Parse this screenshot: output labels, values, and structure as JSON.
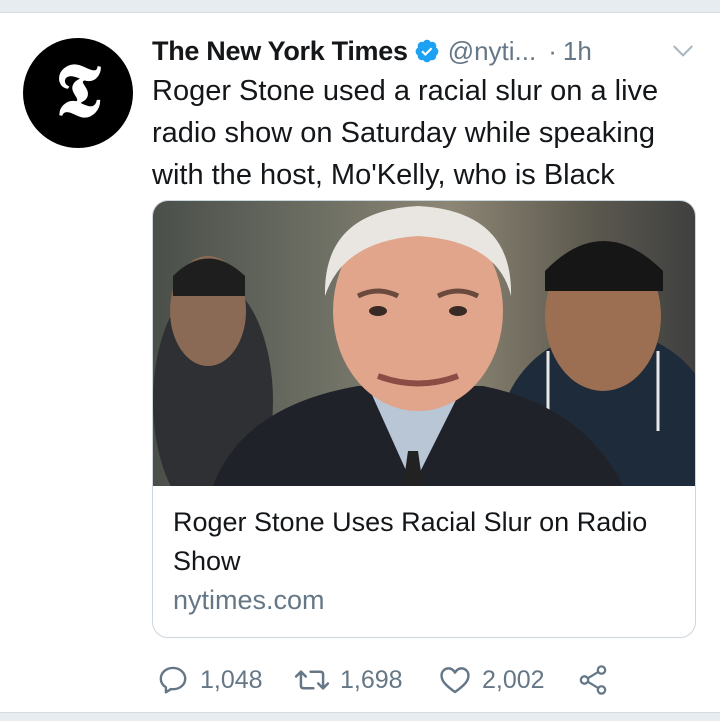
{
  "account": {
    "name": "The New York Times",
    "handle": "@nyti...",
    "separator": "·",
    "time": "1h",
    "avatar_glyph": "𝕿"
  },
  "tweet": {
    "text": "Roger Stone used a racial slur on a live radio show on Saturday while speaking with the host, Mo'Kelly, who is Black"
  },
  "card": {
    "title": "Roger Stone Uses Racial Slur on Radio Show",
    "domain": "nytimes.com"
  },
  "actions": {
    "replies": "1,048",
    "retweets": "1,698",
    "likes": "2,002"
  },
  "colors": {
    "verified": "#1da1f2",
    "muted": "#657786",
    "divider": "#e6ecf0"
  },
  "icons": [
    "verified-badge-icon",
    "chevron-down-icon",
    "reply-icon",
    "retweet-icon",
    "heart-icon",
    "share-icon"
  ]
}
